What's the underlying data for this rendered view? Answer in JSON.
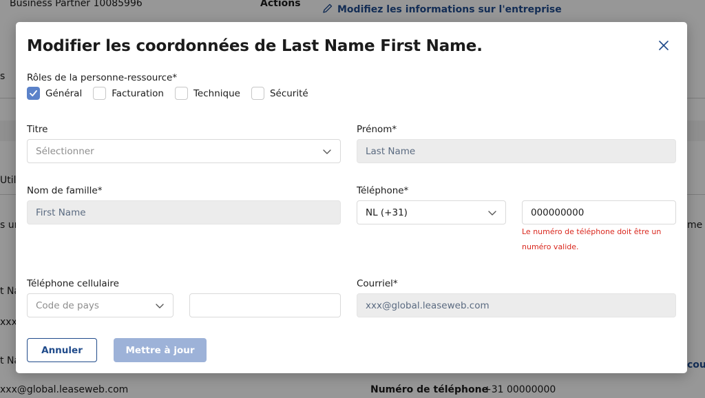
{
  "background": {
    "business_partner": "Business Partner 10085996",
    "actions_label": "Actions",
    "edit_company_link": "Modifiez les informations sur l'entreprise",
    "left_fragments": [
      "s",
      "Util",
      "s un",
      "t Na",
      "xxx",
      "t Na"
    ],
    "right_fragments": [
      "me p",
      "cour"
    ],
    "email": "xxx@global.leaseweb.com",
    "phone_label": "Numéro de téléphone",
    "phone_value": "+31 00000000"
  },
  "modal": {
    "title": "Modifier les coordonnées de Last Name First Name.",
    "roles_label": "Rôles de la personne-ressource*",
    "roles": [
      {
        "label": "Général",
        "checked": true
      },
      {
        "label": "Facturation",
        "checked": false
      },
      {
        "label": "Technique",
        "checked": false
      },
      {
        "label": "Sécurité",
        "checked": false
      }
    ],
    "titre": {
      "label": "Titre",
      "placeholder": "Sélectionner"
    },
    "prenom": {
      "label": "Prénom*",
      "value": "Last Name"
    },
    "nom": {
      "label": "Nom de famille*",
      "value": "First Name"
    },
    "telephone": {
      "label": "Téléphone*",
      "country": "NL (+31)",
      "number": "000000000",
      "error": "Le numéro de téléphone doit être un numéro valide."
    },
    "cellulaire": {
      "label": "Téléphone cellulaire",
      "country_placeholder": "Code de pays",
      "number": ""
    },
    "courriel": {
      "label": "Courriel*",
      "value": "xxx@global.leaseweb.com"
    },
    "buttons": {
      "cancel": "Annuler",
      "update": "Mettre à jour"
    }
  },
  "colors": {
    "primary": "#1f4a8a",
    "checkbox_checked": "#5b82c9",
    "error": "#d9261c",
    "button_disabled": "#9db2d8"
  }
}
